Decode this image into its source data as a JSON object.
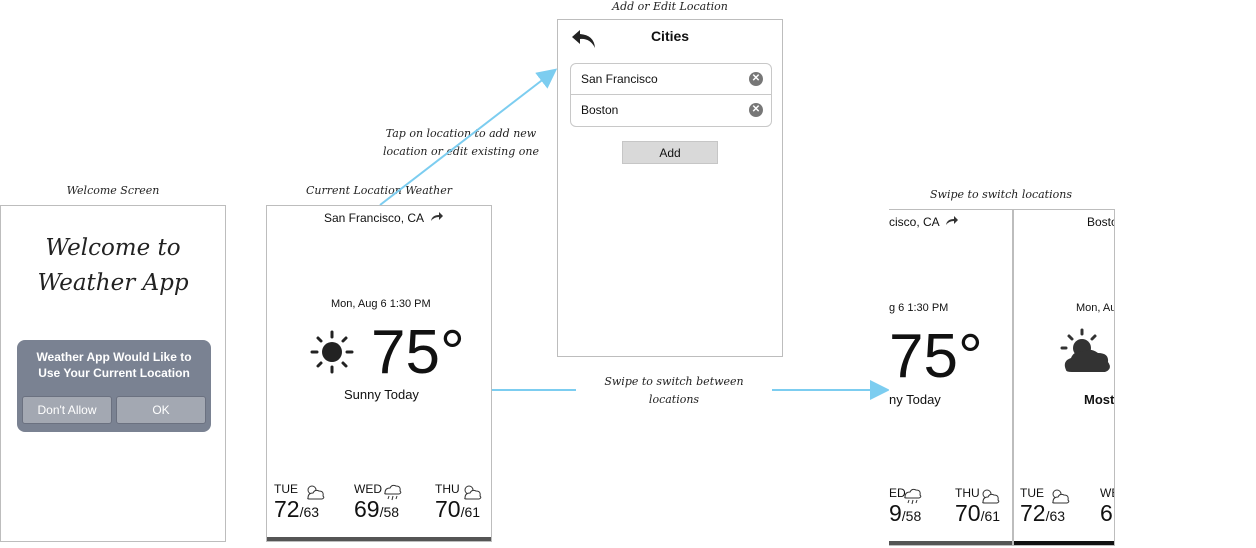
{
  "captions": {
    "welcome": "Welcome Screen",
    "current": "Current Location Weather",
    "add_edit": "Add or Edit Location",
    "tap_note_1": "Tap on location to add new",
    "tap_note_2": "location or edit existing one",
    "swipe_note_1": "Swipe to switch between",
    "swipe_note_2": "locations",
    "swipe_title": "Swipe to switch locations"
  },
  "welcome": {
    "title_line1": "Welcome to",
    "title_line2": "Weather App",
    "alert_line1": "Weather App Would Like to",
    "alert_line2": "Use Your Current Location",
    "deny_label": "Don't Allow",
    "ok_label": "OK"
  },
  "weather": {
    "location": "San Francisco, CA",
    "date": "Mon, Aug 6 1:30 PM",
    "temp": "75°",
    "condition": "Sunny Today",
    "forecast": [
      {
        "day": "TUE",
        "hi": "72",
        "lo": "/63",
        "icon": "partly-cloudy-icon"
      },
      {
        "day": "WED",
        "hi": "69",
        "lo": "/58",
        "icon": "rain-icon"
      },
      {
        "day": "THU",
        "hi": "70",
        "lo": "/61",
        "icon": "partly-cloudy-icon"
      }
    ]
  },
  "cities": {
    "title": "Cities",
    "items": [
      "San Francisco",
      "Boston"
    ],
    "add_label": "Add"
  },
  "swipe_left": {
    "location": "cisco, CA",
    "date": "g 6 1:30 PM",
    "temp": "75°",
    "condition": "ny Today",
    "fc1_day": "ED",
    "fc1_hi": "9",
    "fc1_lo": "/58",
    "fc2_day": "THU",
    "fc2_hi": "70",
    "fc2_lo": "/61"
  },
  "swipe_right": {
    "location": "Bosto",
    "date": "Mon, Au",
    "condition": "Mostl",
    "fc1_day": "TUE",
    "fc1_hi": "72",
    "fc1_lo": "/63",
    "fc2_day": "WE",
    "fc2_hi": "6"
  }
}
